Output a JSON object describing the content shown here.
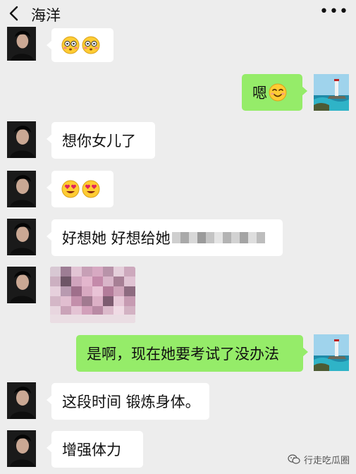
{
  "header": {
    "title": "海洋",
    "back_icon": "chevron-left-icon",
    "more_icon": "more-dots-icon",
    "more_glyph": "•••"
  },
  "messages": [
    {
      "side": "left",
      "type": "emoji",
      "emojis": [
        "flushed-face",
        "flushed-face"
      ]
    },
    {
      "side": "right",
      "type": "text",
      "text": "嗯",
      "emojis": [
        "smiling-face"
      ]
    },
    {
      "side": "left",
      "type": "text",
      "text": "想你女儿了"
    },
    {
      "side": "left",
      "type": "emoji",
      "emojis": [
        "heart-eyes-face",
        "heart-eyes-face"
      ]
    },
    {
      "side": "left",
      "type": "text",
      "text": "好想她 好想给她",
      "note": "rest-of-message-pixelated"
    },
    {
      "side": "left",
      "type": "image",
      "image": "pixelated-photo"
    },
    {
      "side": "right",
      "type": "text",
      "text": "是啊，现在她要考试了没办法"
    },
    {
      "side": "left",
      "type": "text",
      "text": "这段时间 锻炼身体。"
    },
    {
      "side": "left",
      "type": "text",
      "text": "增强体力"
    }
  ],
  "watermark": {
    "text": "行走吃瓜圈",
    "icon": "wechat-official-account-icon"
  },
  "colors": {
    "background": "#ededed",
    "bubble_left": "#ffffff",
    "bubble_right": "#95ec69"
  }
}
